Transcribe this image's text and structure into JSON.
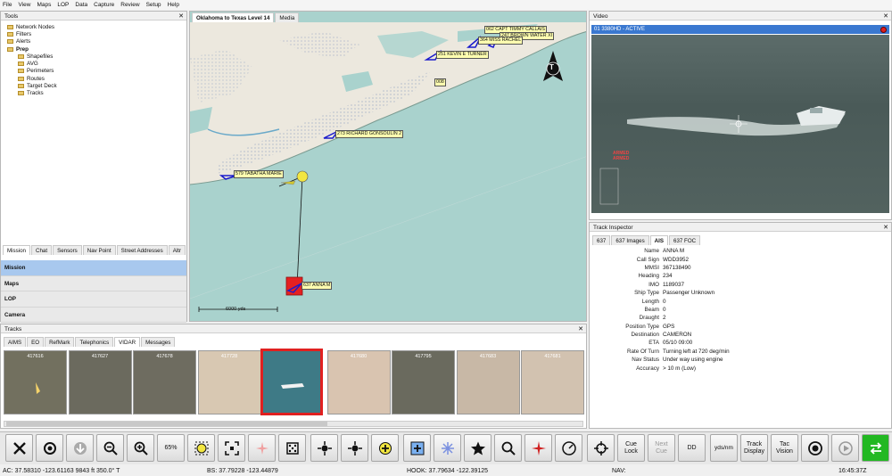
{
  "menu": [
    "File",
    "View",
    "Maps",
    "LOP",
    "Data",
    "Capture",
    "Review",
    "Setup",
    "Help"
  ],
  "tools": {
    "title": "Tools",
    "tree": [
      {
        "label": "Network Nodes",
        "indent": 0,
        "icon": "folder-icon",
        "bold": false
      },
      {
        "label": "Filters",
        "indent": 0,
        "icon": "folder-icon",
        "bold": false
      },
      {
        "label": "Alerts",
        "indent": 0,
        "icon": "folder-icon",
        "bold": false
      },
      {
        "label": "Prep",
        "indent": 0,
        "icon": "folder-icon",
        "bold": true
      },
      {
        "label": "Shapefiles",
        "indent": 1,
        "icon": "folder-icon",
        "bold": false
      },
      {
        "label": "AVG",
        "indent": 1,
        "icon": "folder-icon",
        "bold": false
      },
      {
        "label": "Perimeters",
        "indent": 1,
        "icon": "folder-icon",
        "bold": false
      },
      {
        "label": "Routes",
        "indent": 1,
        "icon": "folder-icon",
        "bold": false
      },
      {
        "label": "Target Deck",
        "indent": 1,
        "icon": "folder-icon",
        "bold": false
      },
      {
        "label": "Tracks",
        "indent": 1,
        "icon": "folder-icon",
        "bold": false
      }
    ],
    "tabs": [
      "Mission",
      "Chat",
      "Sensors",
      "Nav Point",
      "Street Addresses",
      "Altr"
    ],
    "sections": [
      "Mission",
      "Maps",
      "LOP",
      "Camera"
    ]
  },
  "map": {
    "tabs": [
      "Oklahoma to Texas Level 14",
      "Media"
    ],
    "scale_label": "6000 yds",
    "north_letter": "T",
    "labels": [
      "062 CAPT TIMMY CALLAIS",
      "247 BROWN WATER XI",
      "364 MISS RACHEL",
      "251 KEVIN E TURNER",
      "008",
      "273 RICHARD GONSOULIN 2",
      "579 TABATHA MARIE",
      "637 ANNA M"
    ]
  },
  "tracks": {
    "title": "Tracks",
    "tabs": [
      "AIMS",
      "EO",
      "RefMark",
      "Telephonics",
      "VIDAR",
      "Messages"
    ],
    "thumbnails": [
      "417616",
      "417627",
      "417678",
      "417728",
      "",
      "417680",
      "417795",
      "417683",
      "417681"
    ]
  },
  "video": {
    "title": "Video",
    "feed_label": "01 3380HD - ACTIVE",
    "overlay_text": "ARMED"
  },
  "inspector": {
    "title": "Track Inspector",
    "tabs": [
      "637",
      "637 Images",
      "AIS",
      "637 FOC"
    ],
    "rows": [
      {
        "k": "Name",
        "v": "ANNA M"
      },
      {
        "k": "Call Sign",
        "v": "WDD3952"
      },
      {
        "k": "MMSI",
        "v": "367138490"
      },
      {
        "k": "Heading",
        "v": "234"
      },
      {
        "k": "IMO",
        "v": "1189037"
      },
      {
        "k": "Ship Type",
        "v": "Passenger Unknown"
      },
      {
        "k": "Length",
        "v": "0"
      },
      {
        "k": "Beam",
        "v": "0"
      },
      {
        "k": "Draught",
        "v": "2"
      },
      {
        "k": "Position Type",
        "v": "GPS"
      },
      {
        "k": "Destination",
        "v": "CAMERON"
      },
      {
        "k": "ETA",
        "v": "05/10 09:00"
      },
      {
        "k": "Rate Of Turn",
        "v": "Turning left at  720 deg/min"
      },
      {
        "k": "Nav Status",
        "v": "Under way using engine"
      },
      {
        "k": "Accuracy",
        "v": "> 10 m (Low)"
      }
    ]
  },
  "toolbar": {
    "zoom_label": "65%",
    "cue_lock": "Cue Lock",
    "next_cue": "Next Cue",
    "dd": "DD",
    "yds_nm": "yds/nm",
    "track_display": "Track Display",
    "tac_vision": "Tac Vision"
  },
  "status": {
    "ac": "AC:  37.58310 -123.61163  9843 ft    350.0° T",
    "bs": "BS:  37.79228 -123.44879",
    "hook": "HOOK:  37.79634 -122.39125",
    "nav": "NAV:",
    "time": "16:45:37Z"
  },
  "colors": {
    "accent": "#1e6fd0",
    "selected": "#a8c8ee",
    "track_red": "#e02020",
    "track_line": "#1a1acc"
  }
}
